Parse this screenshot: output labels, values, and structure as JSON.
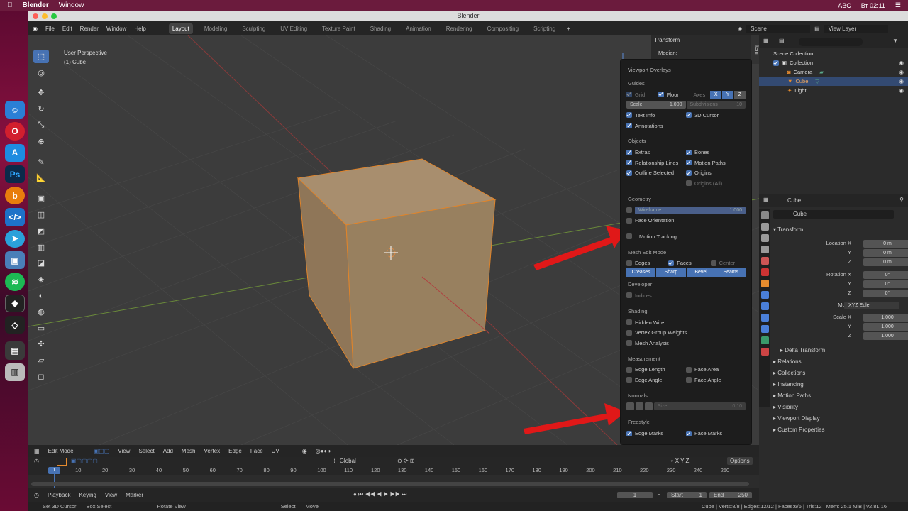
{
  "mac": {
    "app": "Blender",
    "menu_window": "Window",
    "time": "Вт 02:11",
    "input": "ABC"
  },
  "window_title": "Blender",
  "topbar": {
    "menus": [
      "File",
      "Edit",
      "Render",
      "Window",
      "Help"
    ],
    "workspaces": [
      "Layout",
      "Modeling",
      "Sculpting",
      "UV Editing",
      "Texture Paint",
      "Shading",
      "Animation",
      "Rendering",
      "Compositing",
      "Scripting"
    ],
    "active": "Layout",
    "scene": "Scene",
    "view_layer": "View Layer"
  },
  "viewport": {
    "perspective": "User Perspective",
    "object": "(1) Cube"
  },
  "npanel": {
    "title": "Transform",
    "median": "Median:",
    "tab": "Item"
  },
  "overlays": {
    "title": "Viewport Overlays",
    "guides": {
      "label": "Guides",
      "grid": "Grid",
      "floor": "Floor",
      "axes": "Axes",
      "x": "X",
      "y": "Y",
      "z": "Z",
      "scale": "Scale",
      "scale_val": "1.000",
      "subdiv": "Subdivisions",
      "subdiv_val": "10",
      "text_info": "Text Info",
      "cursor": "3D Cursor",
      "annotations": "Annotations"
    },
    "objects": {
      "label": "Objects",
      "extras": "Extras",
      "bones": "Bones",
      "rel": "Relationship Lines",
      "motion": "Motion Paths",
      "outline": "Outline Selected",
      "origins": "Origins",
      "origins_all": "Origins (All)"
    },
    "geometry": {
      "label": "Geometry",
      "wire": "Wireframe",
      "wire_val": "1.000",
      "face_orient": "Face Orientation",
      "motion_tracking": "Motion Tracking"
    },
    "mesh": {
      "label": "Mesh Edit Mode",
      "edges": "Edges",
      "faces": "Faces",
      "center": "Center",
      "creases": "Creases",
      "sharp": "Sharp",
      "bevel": "Bevel",
      "seams": "Seams"
    },
    "developer": {
      "label": "Developer",
      "indices": "Indices"
    },
    "shading": {
      "label": "Shading",
      "hidden": "Hidden Wire",
      "vgroup": "Vertex Group Weights",
      "analysis": "Mesh Analysis"
    },
    "measure": {
      "label": "Measurement",
      "elen": "Edge Length",
      "farea": "Face Area",
      "eangle": "Edge Angle",
      "fangle": "Face Angle"
    },
    "normals": {
      "label": "Normals",
      "size": "Size",
      "size_val": "0.10"
    },
    "freestyle": {
      "label": "Freestyle",
      "emarks": "Edge Marks",
      "fmarks": "Face Marks"
    }
  },
  "outliner": {
    "scene": "Scene Collection",
    "collection": "Collection",
    "camera": "Camera",
    "cube": "Cube",
    "light": "Light"
  },
  "properties": {
    "object": "Cube",
    "name": "Cube",
    "transform": "Transform",
    "loc": "Location X",
    "rot": "Rotation X",
    "mode": "Mode",
    "mode_val": "XYZ Euler",
    "scale": "Scale X",
    "y": "Y",
    "z": "Z",
    "loc_vals": [
      "0 m",
      "0 m",
      "0 m"
    ],
    "rot_vals": [
      "0°",
      "0°",
      "0°"
    ],
    "scale_vals": [
      "1.000",
      "1.000",
      "1.000"
    ],
    "sections": [
      "Delta Transform",
      "Relations",
      "Collections",
      "Instancing",
      "Motion Paths",
      "Visibility",
      "Viewport Display",
      "Custom Properties"
    ]
  },
  "bottom": {
    "mode": "Edit Mode",
    "menus": [
      "View",
      "Select",
      "Add",
      "Mesh",
      "Vertex",
      "Edge",
      "Face",
      "UV"
    ],
    "orient": "Global",
    "options": "Options"
  },
  "timeline": {
    "ticks": [
      "1",
      "10",
      "20",
      "30",
      "40",
      "50",
      "60",
      "70",
      "80",
      "90",
      "100",
      "110",
      "120",
      "130",
      "140",
      "150",
      "160",
      "170",
      "180",
      "190",
      "200",
      "210",
      "220",
      "230",
      "240",
      "250"
    ],
    "current": "1",
    "start_label": "Start",
    "start": "1",
    "end_label": "End",
    "end": "250"
  },
  "playback": {
    "items": [
      "Playback",
      "Keying",
      "View",
      "Marker"
    ]
  },
  "status": {
    "items": [
      "Set 3D Cursor",
      "Box Select",
      "Rotate View",
      "Select",
      "Move"
    ],
    "right": "Cube | Verts:8/8 | Edges:12/12 | Faces:6/6 | Tris:12 | Mem: 25.1 MiB | v2.81.16"
  }
}
